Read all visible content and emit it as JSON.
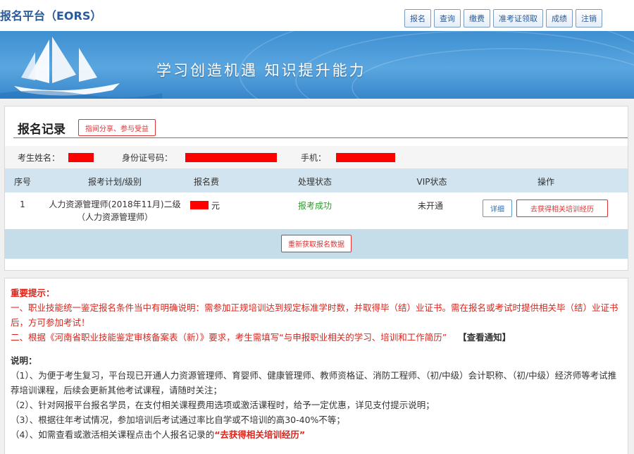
{
  "header": {
    "site_title": "报名平台（EORS）",
    "nav": [
      "报名",
      "查询",
      "缴费",
      "准考证领取",
      "成绩",
      "注销"
    ]
  },
  "banner": {
    "slogan": "学习创造机遇   知识提升能力"
  },
  "record": {
    "title": "报名记录",
    "share_btn": "指间分享、参与受益",
    "labels": {
      "name": "考生姓名：",
      "id": "身份证号码：",
      "phone": "手机："
    },
    "columns": [
      "序号",
      "报考计划/级别",
      "报名费",
      "处理状态",
      "VIP状态",
      "操作"
    ],
    "rows": [
      {
        "index": "1",
        "plan": "人力资源管理师(2018年11月)二级（人力资源管理师）",
        "fee_unit": "元",
        "status": "报考成功",
        "vip": "未开通",
        "detail_btn": "详细",
        "training_btn": "去获得相关培训经历"
      }
    ],
    "refresh_btn": "重新获取报名数据"
  },
  "notes": {
    "important_title": "重要提示：",
    "tip1": "一、职业技能统一鉴定报名条件当中有明确说明：需参加正规培训达到规定标准学时数，并取得毕（结）业证书。需在报名或考试时提供相关毕（结）业证书后，方可参加考试！",
    "tip2": "二、根据《河南省职业技能鉴定审核备案表（新）》要求，考生需填写“与申报职业相关的学习、培训和工作简历”",
    "tip2_link": "【查看通知】",
    "explain_title": "说明：",
    "item1": "（1）、为便于考生复习，平台现已开通人力资源管理师、育婴师、健康管理师、教师资格证、消防工程师、（初/中级）会计职称、（初/中级）经济师等考试推荐培训课程，后续会更新其他考试课程，请随时关注；",
    "item2": "（2）、针对网报平台报名学员，在支付相关课程费用选项或激活课程时，给予一定优惠，详见支付提示说明；",
    "item3": "（3）、根据往年考试情况，参加培训后考试通过率比自学或不培训的高30-40%不等；",
    "item4": "（4）、如需查看或激活相关课程点击个人报名记录的",
    "item4_link": "“去获得相关培训经历”"
  },
  "colors": {
    "accent": "#2a5a9a",
    "danger": "#d9251c",
    "success": "#2e9b2e",
    "table_header": "#d1e4ef"
  }
}
